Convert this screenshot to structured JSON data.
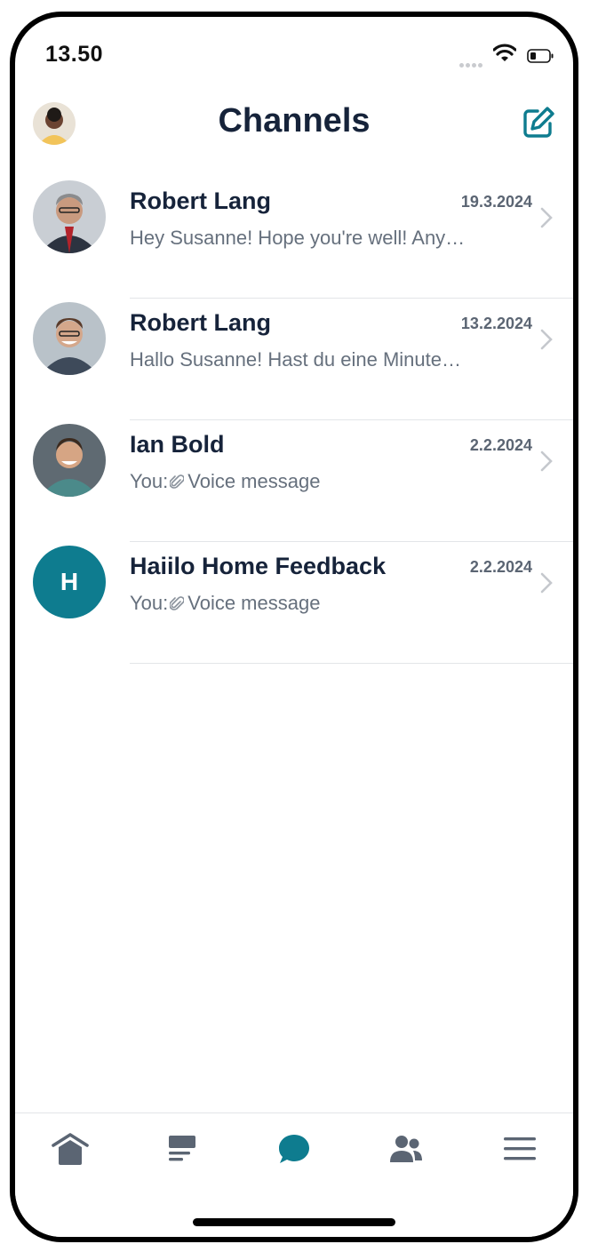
{
  "status": {
    "time": "13.50"
  },
  "header": {
    "title": "Channels"
  },
  "channels": [
    {
      "name": "Robert Lang",
      "date": "19.3.2024",
      "preview": "Hey Susanne! Hope you're well! Any…",
      "you_prefix": "",
      "avatar": "photo"
    },
    {
      "name": "Robert Lang",
      "date": "13.2.2024",
      "preview": "Hallo Susanne! Hast du eine Minute…",
      "you_prefix": "",
      "avatar": "photo"
    },
    {
      "name": "Ian Bold",
      "date": "2.2.2024",
      "preview": "Voice message",
      "you_prefix": "You:",
      "avatar": "photo"
    },
    {
      "name": "Haiilo Home Feedback",
      "date": "2.2.2024",
      "preview": "Voice message",
      "you_prefix": "You:",
      "avatar_initial": "H"
    }
  ],
  "tabs": [
    {
      "icon": "home-icon",
      "active": false
    },
    {
      "icon": "timeline-icon",
      "active": false
    },
    {
      "icon": "chat-icon",
      "active": true
    },
    {
      "icon": "people-icon",
      "active": false
    },
    {
      "icon": "menu-icon",
      "active": false
    }
  ],
  "colors": {
    "accent": "#0e7c8f",
    "text_dark": "#16233a",
    "text_muted": "#66707d",
    "icon_gray": "#5b6573"
  }
}
